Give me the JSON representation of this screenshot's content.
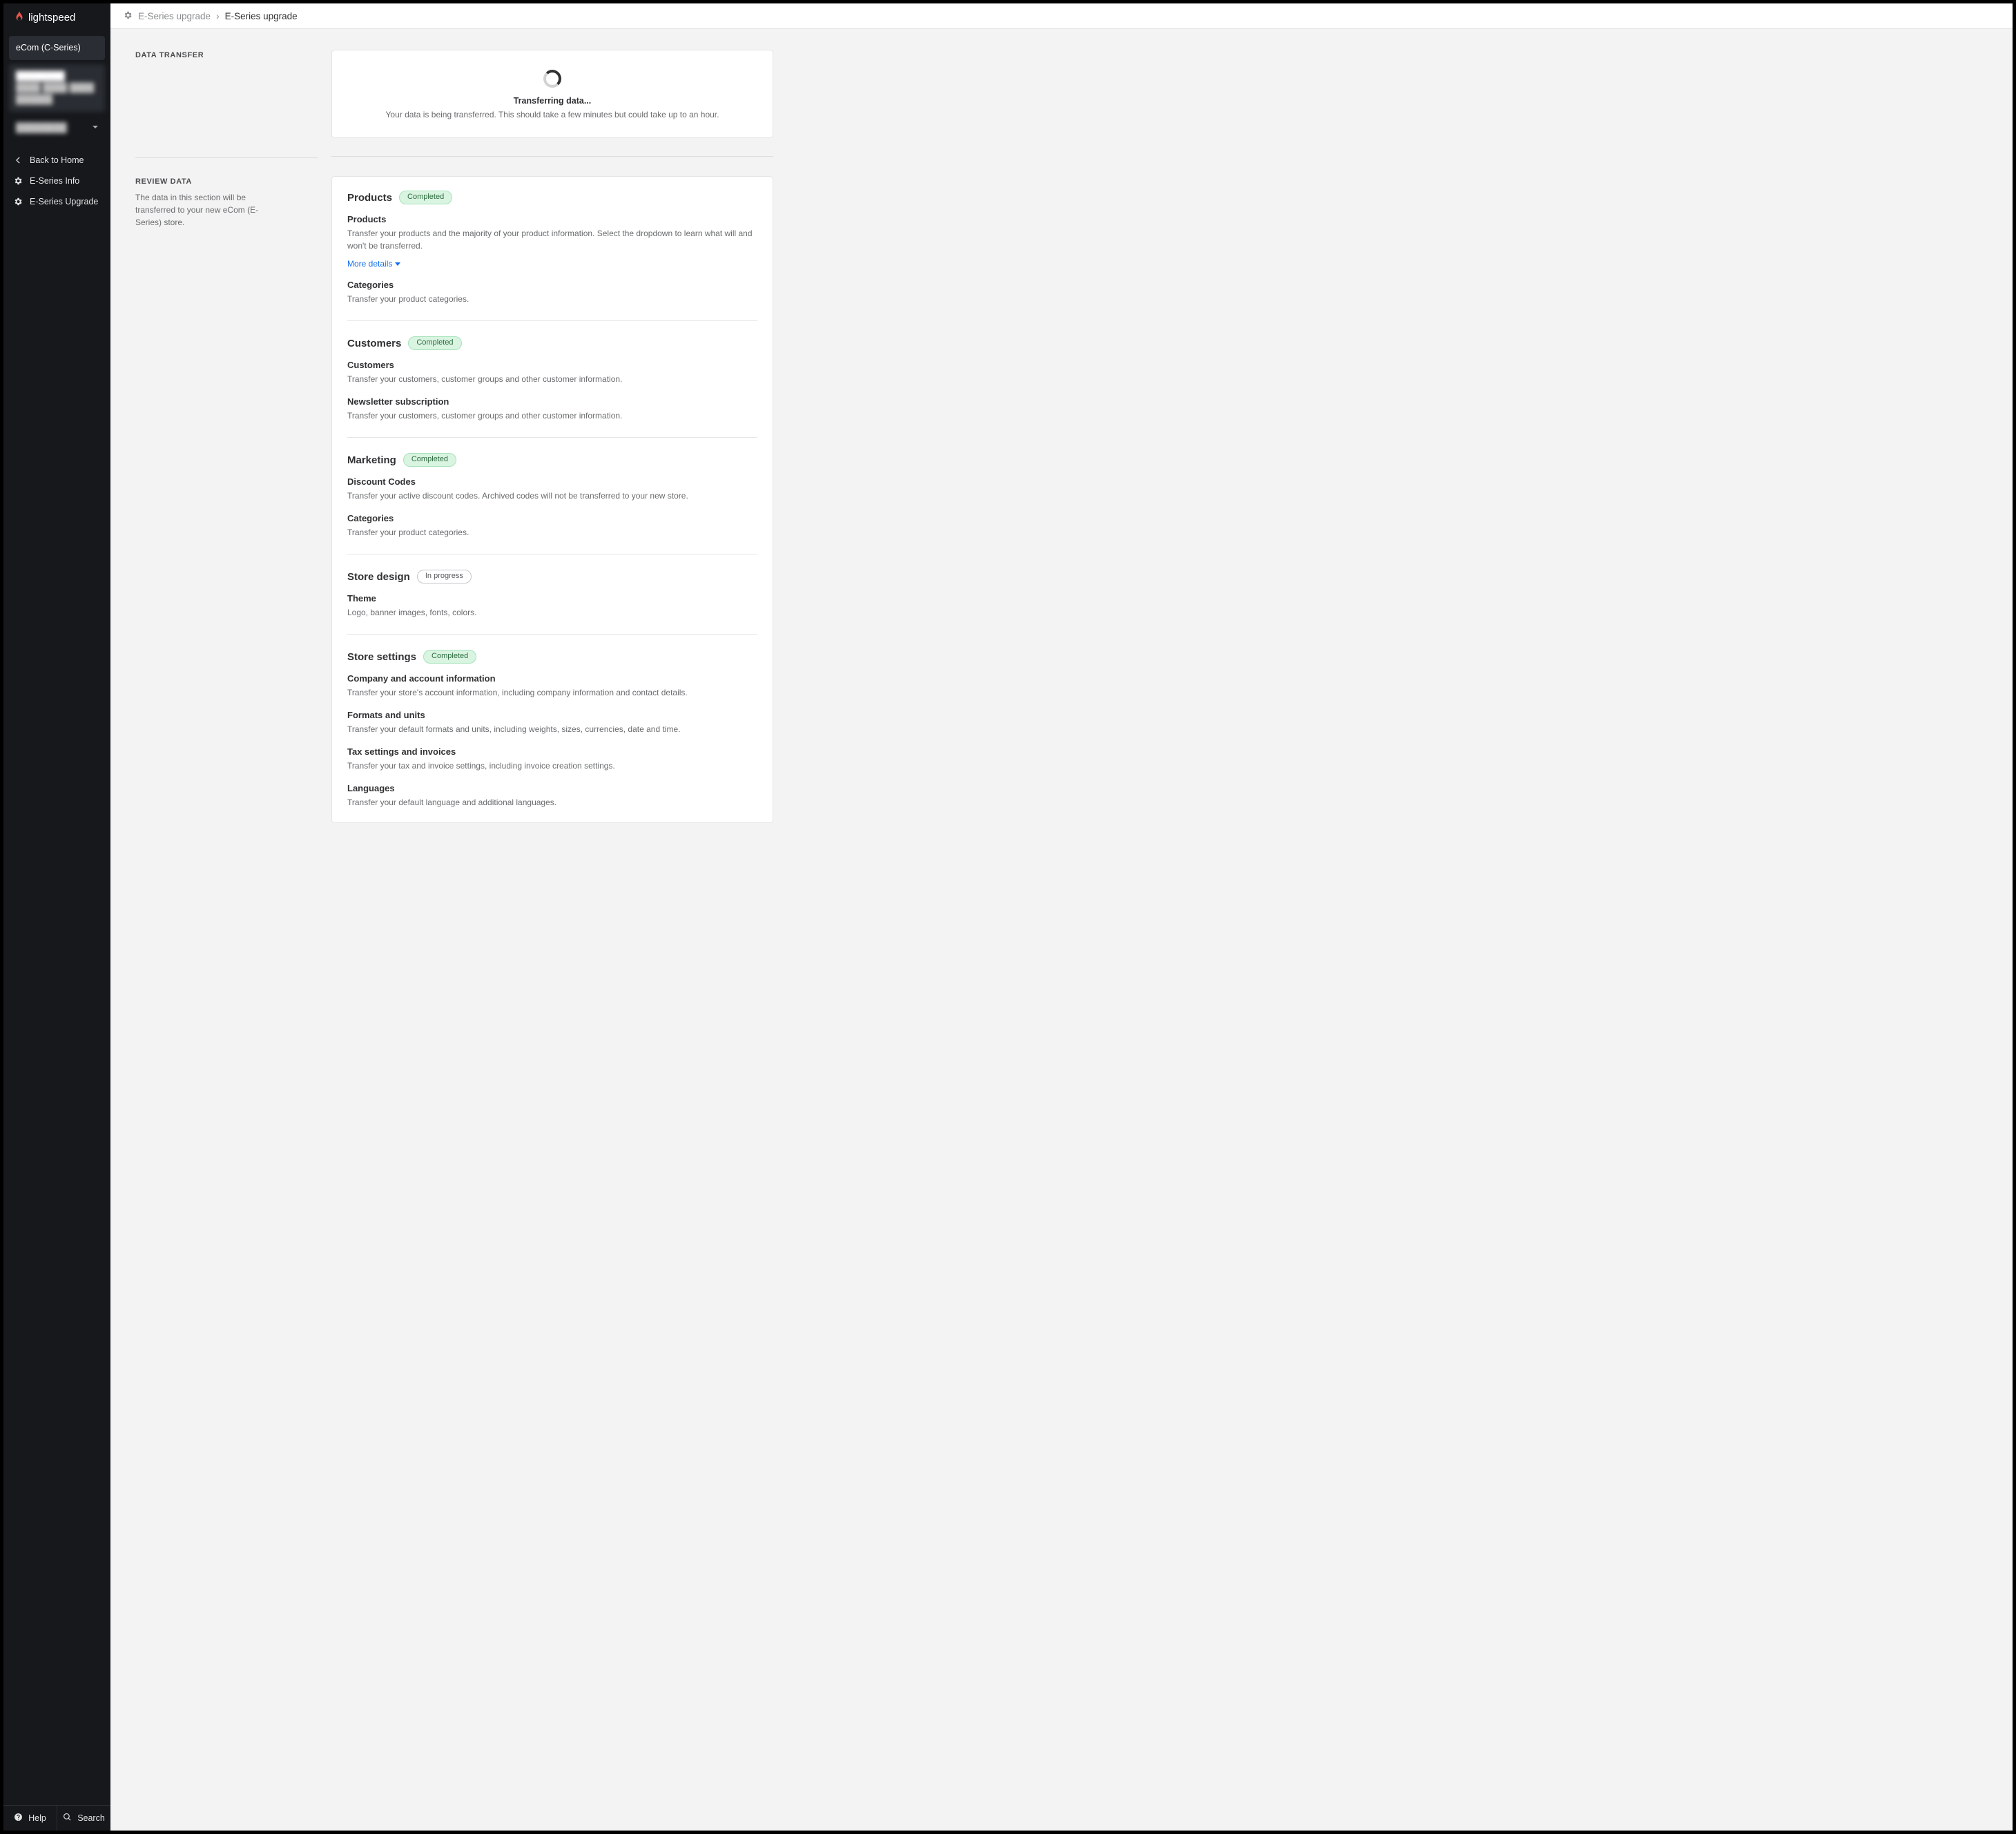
{
  "brand": {
    "name": "lightspeed"
  },
  "sidebar": {
    "context": {
      "title": "eCom (C-Series)",
      "obscured_1": "████████",
      "obscured_2": "████ ████ ████ ██████",
      "obscured_3": "████████"
    },
    "nav": [
      {
        "label": "Back to Home",
        "icon": "chevron-left"
      },
      {
        "label": "E-Series Info",
        "icon": "gear"
      },
      {
        "label": "E-Series Upgrade",
        "icon": "gear"
      }
    ],
    "footer": {
      "help": "Help",
      "search": "Search"
    }
  },
  "breadcrumb": {
    "parent": "E-Series upgrade",
    "current": "E-Series upgrade"
  },
  "data_transfer": {
    "heading": "DATA TRANSFER",
    "title": "Transferring data...",
    "desc": "Your data is being transferred. This should take a few minutes but could take up to an hour."
  },
  "review_data": {
    "heading": "REVIEW DATA",
    "sub": "The data in this section will be transferred to your new eCom (E-Series) store.",
    "more_details_label": "More details",
    "groups": [
      {
        "title": "Products",
        "status": "Completed",
        "status_type": "completed",
        "items": [
          {
            "title": "Products",
            "desc": "Transfer your products and the majority of your product information. Select the dropdown to learn what will and won't be transferred.",
            "has_more": true
          },
          {
            "title": "Categories",
            "desc": "Transfer your product categories."
          }
        ]
      },
      {
        "title": "Customers",
        "status": "Completed",
        "status_type": "completed",
        "items": [
          {
            "title": "Customers",
            "desc": "Transfer your customers, customer groups and other customer information."
          },
          {
            "title": "Newsletter subscription",
            "desc": "Transfer your customers, customer groups and other customer information."
          }
        ]
      },
      {
        "title": "Marketing",
        "status": "Completed",
        "status_type": "completed",
        "items": [
          {
            "title": "Discount Codes",
            "desc": "Transfer your active discount codes. Archived codes will not be transferred to your new store."
          },
          {
            "title": "Categories",
            "desc": "Transfer your product categories."
          }
        ]
      },
      {
        "title": "Store design",
        "status": "In progress",
        "status_type": "in-progress",
        "items": [
          {
            "title": "Theme",
            "desc": "Logo, banner images, fonts, colors."
          }
        ]
      },
      {
        "title": "Store settings",
        "status": "Completed",
        "status_type": "completed",
        "items": [
          {
            "title": "Company and account information",
            "desc": "Transfer your store's account information, including company information and contact details."
          },
          {
            "title": "Formats and units",
            "desc": "Transfer your default formats and units, including weights, sizes, currencies, date and time."
          },
          {
            "title": "Tax settings and invoices",
            "desc": "Transfer your tax and invoice settings, including invoice creation settings."
          },
          {
            "title": "Languages",
            "desc": "Transfer your default language and additional languages."
          }
        ]
      }
    ]
  }
}
